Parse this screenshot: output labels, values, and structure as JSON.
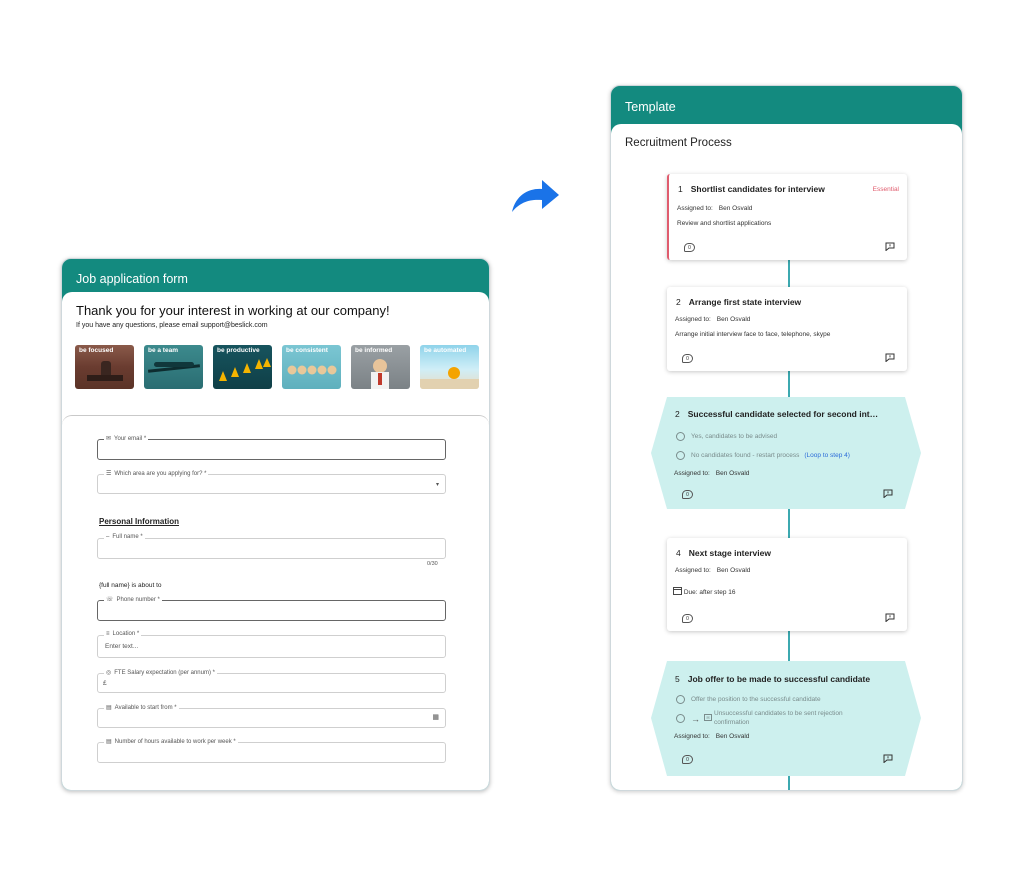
{
  "form": {
    "header": "Job application form",
    "thanks": "Thank you for your interest in working at our company!",
    "support": "If you have any questions, please email support@beslick.com",
    "tiles": [
      "be focused",
      "be a team",
      "be productive",
      "be consistent",
      "be informed",
      "be automated"
    ],
    "fields": {
      "email": {
        "label": "Your email *"
      },
      "area": {
        "label": "Which area are you applying for? *"
      },
      "section": "Personal Information",
      "full_name": {
        "label": "Full name *",
        "counter": "0/30"
      },
      "about": "{full name} is about to",
      "phone": {
        "label": "Phone number *"
      },
      "location": {
        "label": "Location *",
        "placeholder": "Enter text..."
      },
      "salary": {
        "label": "FTE Salary expectation (per annum) *",
        "prefix": "£"
      },
      "start": {
        "label": "Available to start from *"
      },
      "hours": {
        "label": "Number of hours available to work per week *"
      }
    }
  },
  "template": {
    "header": "Template",
    "title": "Recruitment Process",
    "steps": [
      {
        "num": "1",
        "title": "Shortlist candidates for interview",
        "badge": "Essential",
        "assigned_label": "Assigned to:",
        "assignee": "Ben Osvald",
        "desc": "Review and shortlist applications",
        "count": "0"
      },
      {
        "num": "2",
        "title": "Arrange first state interview",
        "assigned_label": "Assigned to:",
        "assignee": "Ben Osvald",
        "desc": "Arrange initial interview face to face, telephone, skype",
        "count": "0"
      },
      {
        "num": "2",
        "title": "Successful candidate selected for second int…",
        "options": [
          "Yes, candidates to be advised",
          "No candidates found - restart process"
        ],
        "loop": "(Loop to step 4)",
        "assigned_label": "Assigned to:",
        "assignee": "Ben Osvald",
        "count": "0"
      },
      {
        "num": "4",
        "title": "Next stage interview",
        "assigned_label": "Assigned to:",
        "assignee": "Ben Osvald",
        "due": "Due: after step 16",
        "count": "0"
      },
      {
        "num": "5",
        "title": "Job offer to be made to successful candidate",
        "options": [
          "Offer the position to the successful candidate",
          "Unsuccessful candidates to be sent rejection confirmation"
        ],
        "assigned_label": "Assigned to:",
        "assignee": "Ben Osvald",
        "count": "0"
      }
    ]
  },
  "colors": {
    "teal": "#138a7f",
    "essential": "#e05c6e",
    "decision_fill": "#cdf0ee",
    "link": "#2b6bd8",
    "arrow": "#1a73e8"
  },
  "icons": [
    "mail-icon",
    "list-icon",
    "phone-icon",
    "location-icon",
    "currency-icon",
    "calendar-icon",
    "chevron-down-icon",
    "comment-icon",
    "message-bubble-icon",
    "forward-arrow-icon"
  ]
}
